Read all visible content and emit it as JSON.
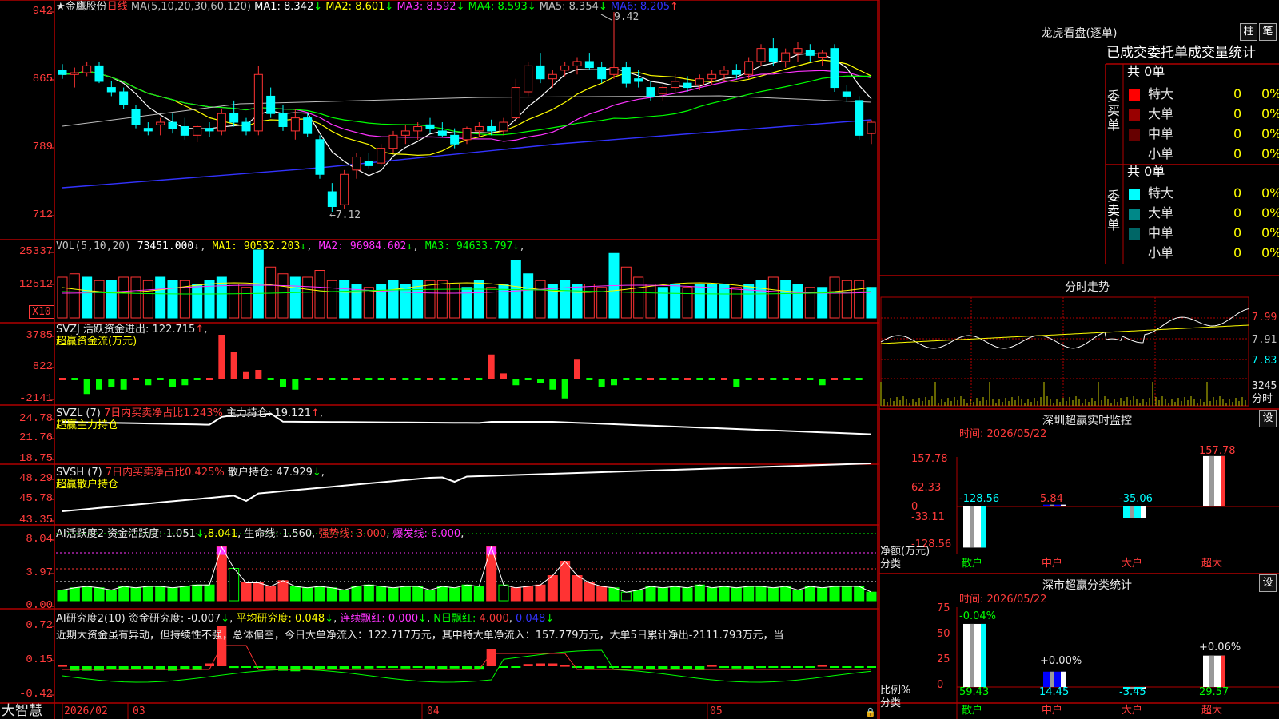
{
  "app": {
    "brand": "大智慧"
  },
  "kline": {
    "title": "★金鹰股份",
    "period": "日线",
    "ma_label": "MA(5,10,20,30,60,120)",
    "ma": [
      {
        "name": "MA1:",
        "value": "8.342",
        "dir": "↓",
        "color": "#ffffff"
      },
      {
        "name": "MA2:",
        "value": "8.601",
        "dir": "↓",
        "color": "#ffff00"
      },
      {
        "name": "MA3:",
        "value": "8.592",
        "dir": "↓",
        "color": "#ff33ff"
      },
      {
        "name": "MA4:",
        "value": "8.593",
        "dir": "↓",
        "color": "#00ff00"
      },
      {
        "name": "MA5:",
        "value": "8.354",
        "dir": "↓",
        "color": "#c0c0c0"
      },
      {
        "name": "MA6:",
        "value": "8.205",
        "dir": "↑",
        "color": "#3333ff"
      }
    ],
    "y_ticks": [
      "942",
      "865",
      "789",
      "712"
    ],
    "high_label": "9.42",
    "low_label": "←7.12"
  },
  "vol": {
    "label": "VOL(5,10,20)",
    "value": "73451.000",
    "dir": "↓",
    "ma": [
      {
        "name": "MA1:",
        "value": "90532.203",
        "dir": "↓",
        "color": "#ffff00"
      },
      {
        "name": "MA2:",
        "value": "96984.602",
        "dir": "↓",
        "color": "#ff33ff"
      },
      {
        "name": "MA3:",
        "value": "94633.797",
        "dir": "↓",
        "color": "#00ff00"
      }
    ],
    "y_ticks": [
      "25337",
      "12512"
    ],
    "unit": "X10"
  },
  "svzj": {
    "label": "SVZJ  活跃资金进出:",
    "value": "122.715",
    "dir": "↑",
    "sub": "超赢资金流(万元)",
    "y_ticks": [
      "3785",
      "822",
      "-2141"
    ]
  },
  "svzl": {
    "label": "SVZL (7)",
    "hl": "7日内买卖净占比1.243%",
    "main": "主力持仓:",
    "value": "19.121",
    "dir": "↑",
    "sub": "超赢主力持仓",
    "y_ticks": [
      "24.78",
      "21.76",
      "18.75"
    ]
  },
  "svsh": {
    "label": "SVSH (7)",
    "hl": "7日内买卖净占比0.425%",
    "main": "散户持仓:",
    "value": "47.929",
    "dir": "↓",
    "sub": "超赢散户持仓",
    "y_ticks": [
      "48.29",
      "45.78",
      "43.35"
    ]
  },
  "ai1": {
    "label": "AI活跃度2 资金活跃度:",
    "v1": "1.051",
    "d1": "↓",
    "v2": "8.041",
    "d2": ",",
    "life": "生命线:",
    "v3": "1.560",
    "strong": "强势线:",
    "v4": "3.000",
    "burst": "爆发线:",
    "v5": "6.000",
    "y_ticks": [
      "8.04",
      "3.97",
      "0.00"
    ]
  },
  "ai2": {
    "label": "AI研究度2(10) 资金研究度:",
    "v1": "-0.007",
    "d1": "↓",
    "avg": "平均研究度:",
    "v2": "0.048",
    "d2": "↓",
    "lx": "连续飘红:",
    "v3": "0.000",
    "d3": "↓",
    "n": "N日飘红:",
    "v4": "4.000",
    "v5": "0.048",
    "d5": "↓",
    "text": "近期大资金虽有异动，但持续性不强，总体偏空，今日大单净流入：122.717万元，其中特大单净流入：157.779万元，大单5日累计净出-2111.793万元，当",
    "y_ticks": [
      "0.72",
      "0.15",
      "-0.42"
    ]
  },
  "xaxis": {
    "labels": [
      "2026/02",
      "03",
      "04",
      "05"
    ]
  },
  "lhb": {
    "title": "龙虎看盘(逐单)",
    "btn1": "柱",
    "btn2": "笔",
    "head": "已成交委托单成交量统计",
    "buy": {
      "side": "委买单",
      "total": "共 0单",
      "rows": [
        {
          "name": "特大",
          "v": "0",
          "p": "0%",
          "c": "#ff0000"
        },
        {
          "name": "大单",
          "v": "0",
          "p": "0%",
          "c": "#990000"
        },
        {
          "name": "中单",
          "v": "0",
          "p": "0%",
          "c": "#660000"
        },
        {
          "name": "小单",
          "v": "0",
          "p": "0%",
          "c": ""
        }
      ]
    },
    "sell": {
      "side": "委卖单",
      "total": "共 0单",
      "rows": [
        {
          "name": "特大",
          "v": "0",
          "p": "0%",
          "c": "#00ffff"
        },
        {
          "name": "大单",
          "v": "0",
          "p": "0%",
          "c": "#008888"
        },
        {
          "name": "中单",
          "v": "0",
          "p": "0%",
          "c": "#006666"
        },
        {
          "name": "小单",
          "v": "0",
          "p": "0%",
          "c": ""
        }
      ]
    }
  },
  "fenshi": {
    "title": "分时走势",
    "y_ticks": [
      "7.99",
      "7.91",
      "7.83"
    ],
    "vol_tick": "3245",
    "unit": "分时"
  },
  "sz_monitor": {
    "title": "深圳超赢实时监控",
    "btn": "设",
    "time": "时间: 2026/05/22",
    "y_ticks": [
      "157.78",
      "62.33",
      "0",
      "-33.11",
      "-128.56"
    ],
    "ylabel": "净额(万元)",
    "xlabel": "分类",
    "cats": [
      "散户",
      "中户",
      "大户",
      "超大"
    ],
    "values": [
      -128.56,
      5.84,
      -35.06,
      157.78
    ],
    "value_labels": [
      "-128.56",
      "5.84",
      "-35.06",
      "157.78"
    ]
  },
  "sz_class": {
    "title": "深市超赢分类统计",
    "btn": "设",
    "time": "时间: 2026/05/22",
    "y_ticks": [
      "75",
      "50",
      "25",
      "0"
    ],
    "ylabel": "比例%",
    "xlabel": "分类",
    "cats": [
      "散户",
      "中户",
      "大户",
      "超大"
    ],
    "values": [
      59.43,
      14.45,
      -3.45,
      29.57
    ],
    "pct": [
      "-0.04%",
      "+0.00%",
      "",
      "+0.06%"
    ],
    "value_labels": [
      "59.43",
      "14.45",
      "-3.45",
      "29.57"
    ]
  },
  "chart_data": [
    {
      "type": "bar",
      "title": "深圳超赢实时监控",
      "categories": [
        "散户",
        "中户",
        "大户",
        "超大"
      ],
      "values": [
        -128.56,
        5.84,
        -35.06,
        157.78
      ],
      "ylabel": "净额(万元)",
      "xlabel": "分类",
      "ylim": [
        -128.56,
        157.78
      ]
    },
    {
      "type": "bar",
      "title": "深市超赢分类统计",
      "categories": [
        "散户",
        "中户",
        "大户",
        "超大"
      ],
      "values": [
        59.43,
        14.45,
        -3.45,
        29.57
      ],
      "ylabel": "比例%",
      "xlabel": "分类",
      "ylim": [
        0,
        75
      ]
    }
  ],
  "candles": [
    [
      8.75,
      8.82,
      8.65,
      8.7
    ],
    [
      8.7,
      8.78,
      8.55,
      8.72
    ],
    [
      8.72,
      8.85,
      8.68,
      8.8
    ],
    [
      8.8,
      8.85,
      8.6,
      8.62
    ],
    [
      8.55,
      8.62,
      8.45,
      8.5
    ],
    [
      8.5,
      8.55,
      8.3,
      8.35
    ],
    [
      8.3,
      8.35,
      8.08,
      8.12
    ],
    [
      8.08,
      8.15,
      8.0,
      8.05
    ],
    [
      8.12,
      8.2,
      8.0,
      8.15
    ],
    [
      8.15,
      8.25,
      8.02,
      8.08
    ],
    [
      8.1,
      8.2,
      7.95,
      8.0
    ],
    [
      8.0,
      8.12,
      7.92,
      8.1
    ],
    [
      8.08,
      8.15,
      7.98,
      8.05
    ],
    [
      8.05,
      8.3,
      8.0,
      8.25
    ],
    [
      8.25,
      8.4,
      8.1,
      8.15
    ],
    [
      8.15,
      8.2,
      8.0,
      8.05
    ],
    [
      8.05,
      8.8,
      8.0,
      8.7
    ],
    [
      8.45,
      8.55,
      8.2,
      8.25
    ],
    [
      8.25,
      8.35,
      8.05,
      8.1
    ],
    [
      8.05,
      8.3,
      7.95,
      8.2
    ],
    [
      8.2,
      8.25,
      7.98,
      8.02
    ],
    [
      7.95,
      8.0,
      7.5,
      7.55
    ],
    [
      7.35,
      7.45,
      7.12,
      7.18
    ],
    [
      7.2,
      7.6,
      7.15,
      7.55
    ],
    [
      7.6,
      7.8,
      7.5,
      7.75
    ],
    [
      7.7,
      7.8,
      7.62,
      7.65
    ],
    [
      7.68,
      7.9,
      7.65,
      7.85
    ],
    [
      7.85,
      8.05,
      7.8,
      8.0
    ],
    [
      8.0,
      8.12,
      7.9,
      8.05
    ],
    [
      8.05,
      8.15,
      7.95,
      8.1
    ],
    [
      8.12,
      8.2,
      8.02,
      8.08
    ],
    [
      8.05,
      8.15,
      7.98,
      8.0
    ],
    [
      8.0,
      8.08,
      7.85,
      7.9
    ],
    [
      7.95,
      8.1,
      7.9,
      8.08
    ],
    [
      8.05,
      8.15,
      7.98,
      8.1
    ],
    [
      8.1,
      8.18,
      8.0,
      8.05
    ],
    [
      8.05,
      8.2,
      8.0,
      8.15
    ],
    [
      8.2,
      8.65,
      8.15,
      8.55
    ],
    [
      8.5,
      8.85,
      8.45,
      8.8
    ],
    [
      8.8,
      8.95,
      8.6,
      8.65
    ],
    [
      8.65,
      8.75,
      8.55,
      8.7
    ],
    [
      8.75,
      8.85,
      8.68,
      8.8
    ],
    [
      8.8,
      8.9,
      8.7,
      8.85
    ],
    [
      8.85,
      8.95,
      8.75,
      8.78
    ],
    [
      8.78,
      8.85,
      8.6,
      8.65
    ],
    [
      8.7,
      9.42,
      8.65,
      8.78
    ],
    [
      8.78,
      8.85,
      8.55,
      8.6
    ],
    [
      8.65,
      8.75,
      8.55,
      8.62
    ],
    [
      8.55,
      8.62,
      8.4,
      8.45
    ],
    [
      8.48,
      8.58,
      8.4,
      8.55
    ],
    [
      8.55,
      8.7,
      8.48,
      8.62
    ],
    [
      8.6,
      8.68,
      8.5,
      8.55
    ],
    [
      8.58,
      8.7,
      8.52,
      8.65
    ],
    [
      8.65,
      8.75,
      8.58,
      8.7
    ],
    [
      8.7,
      8.8,
      8.62,
      8.75
    ],
    [
      8.75,
      8.82,
      8.65,
      8.7
    ],
    [
      8.7,
      8.9,
      8.65,
      8.85
    ],
    [
      8.85,
      9.05,
      8.8,
      9.0
    ],
    [
      9.0,
      9.12,
      8.8,
      8.85
    ],
    [
      8.85,
      9.0,
      8.78,
      8.95
    ],
    [
      8.95,
      9.08,
      8.85,
      9.0
    ],
    [
      8.98,
      9.05,
      8.85,
      8.92
    ],
    [
      8.9,
      8.98,
      8.8,
      8.95
    ],
    [
      9.0,
      9.05,
      8.5,
      8.55
    ],
    [
      8.5,
      8.58,
      8.38,
      8.45
    ],
    [
      8.4,
      8.45,
      7.95,
      8.0
    ],
    [
      8.02,
      8.18,
      7.9,
      8.15
    ]
  ],
  "vol_bars": [
    [
      1,
      0.6
    ],
    [
      1,
      0.65
    ],
    [
      0,
      0.6
    ],
    [
      1,
      0.55
    ],
    [
      0,
      0.55
    ],
    [
      1,
      0.6
    ],
    [
      1,
      0.6
    ],
    [
      1,
      0.55
    ],
    [
      0,
      0.6
    ],
    [
      0,
      0.55
    ],
    [
      1,
      0.55
    ],
    [
      0,
      0.5
    ],
    [
      0,
      0.55
    ],
    [
      0,
      0.6
    ],
    [
      1,
      0.5
    ],
    [
      1,
      0.45
    ],
    [
      0,
      1.0
    ],
    [
      1,
      0.75
    ],
    [
      1,
      0.65
    ],
    [
      0,
      0.6
    ],
    [
      1,
      0.6
    ],
    [
      1,
      0.7
    ],
    [
      1,
      0.55
    ],
    [
      0,
      0.55
    ],
    [
      0,
      0.5
    ],
    [
      1,
      0.45
    ],
    [
      0,
      0.5
    ],
    [
      0,
      0.55
    ],
    [
      0,
      0.5
    ],
    [
      0,
      0.55
    ],
    [
      1,
      0.55
    ],
    [
      1,
      0.55
    ],
    [
      1,
      0.5
    ],
    [
      0,
      0.45
    ],
    [
      0,
      0.55
    ],
    [
      1,
      0.45
    ],
    [
      0,
      0.5
    ],
    [
      0,
      0.85
    ],
    [
      0,
      0.65
    ],
    [
      1,
      0.55
    ],
    [
      0,
      0.5
    ],
    [
      0,
      0.55
    ],
    [
      0,
      0.5
    ],
    [
      1,
      0.5
    ],
    [
      1,
      0.45
    ],
    [
      0,
      0.95
    ],
    [
      1,
      0.75
    ],
    [
      1,
      0.6
    ],
    [
      1,
      0.5
    ],
    [
      0,
      0.45
    ],
    [
      0,
      0.5
    ],
    [
      1,
      0.45
    ],
    [
      0,
      0.5
    ],
    [
      0,
      0.5
    ],
    [
      0,
      0.5
    ],
    [
      1,
      0.45
    ],
    [
      0,
      0.5
    ],
    [
      0,
      0.55
    ],
    [
      1,
      0.6
    ],
    [
      0,
      0.55
    ],
    [
      0,
      0.5
    ],
    [
      1,
      0.45
    ],
    [
      0,
      0.45
    ],
    [
      1,
      0.6
    ],
    [
      1,
      0.55
    ],
    [
      1,
      0.55
    ],
    [
      0,
      0.45
    ]
  ],
  "svzj_bars": [
    0,
    0,
    -0.35,
    -0.25,
    -0.2,
    -0.25,
    0,
    -0.15,
    0,
    -0.2,
    -0.15,
    0,
    0,
    1.0,
    0.6,
    0.15,
    0.2,
    0,
    -0.2,
    -0.25,
    0,
    0,
    0,
    0,
    0,
    0,
    0,
    0,
    0,
    0,
    0,
    0,
    0,
    0,
    0,
    0.55,
    0.12,
    -0.15,
    0,
    -0.1,
    -0.25,
    -0.45,
    0.45,
    0,
    -0.2,
    -0.15,
    0,
    0,
    0,
    0,
    0,
    0,
    0,
    0,
    0,
    -0.2,
    0,
    0,
    0,
    0,
    0,
    0,
    -0.15,
    0,
    0,
    0
  ],
  "ai_bars": [
    [
      1,
      0.15
    ],
    [
      1,
      0.18
    ],
    [
      1,
      0.2
    ],
    [
      1,
      0.18
    ],
    [
      1,
      0.15
    ],
    [
      1,
      0.2
    ],
    [
      1,
      0.18
    ],
    [
      1,
      0.2
    ],
    [
      1,
      0.2
    ],
    [
      1,
      0.18
    ],
    [
      1,
      0.2
    ],
    [
      1,
      0.22
    ],
    [
      1,
      0.22
    ],
    [
      2,
      0.75
    ],
    [
      3,
      0.45
    ],
    [
      2,
      0.25
    ],
    [
      2,
      0.25
    ],
    [
      2,
      0.2
    ],
    [
      2,
      0.28
    ],
    [
      1,
      0.2
    ],
    [
      1,
      0.18
    ],
    [
      1,
      0.2
    ],
    [
      1,
      0.18
    ],
    [
      1,
      0.15
    ],
    [
      1,
      0.2
    ],
    [
      1,
      0.22
    ],
    [
      1,
      0.2
    ],
    [
      1,
      0.18
    ],
    [
      1,
      0.2
    ],
    [
      1,
      0.2
    ],
    [
      1,
      0.15
    ],
    [
      1,
      0.2
    ],
    [
      1,
      0.18
    ],
    [
      1,
      0.22
    ],
    [
      1,
      0.2
    ],
    [
      2,
      0.75
    ],
    [
      3,
      0.22
    ],
    [
      2,
      0.18
    ],
    [
      2,
      0.2
    ],
    [
      2,
      0.22
    ],
    [
      2,
      0.35
    ],
    [
      2,
      0.55
    ],
    [
      2,
      0.35
    ],
    [
      2,
      0.25
    ],
    [
      2,
      0.2
    ],
    [
      1,
      0.18
    ],
    [
      3,
      0.12
    ],
    [
      1,
      0.15
    ],
    [
      1,
      0.2
    ],
    [
      1,
      0.18
    ],
    [
      1,
      0.2
    ],
    [
      1,
      0.18
    ],
    [
      1,
      0.22
    ],
    [
      1,
      0.18
    ],
    [
      1,
      0.2
    ],
    [
      1,
      0.18
    ],
    [
      1,
      0.2
    ],
    [
      1,
      0.2
    ],
    [
      1,
      0.18
    ],
    [
      1,
      0.2
    ],
    [
      1,
      0.15
    ],
    [
      1,
      0.2
    ],
    [
      1,
      0.18
    ],
    [
      1,
      0.2
    ],
    [
      1,
      0.2
    ],
    [
      1,
      0.2
    ],
    [
      1,
      0.12
    ]
  ],
  "ai2_bars": [
    0.02,
    -0.08,
    -0.08,
    -0.08,
    -0.06,
    -0.07,
    -0.06,
    -0.06,
    -0.07,
    -0.08,
    -0.06,
    -0.07,
    0.05,
    0.72,
    -0.03,
    -0.02,
    -0.02,
    -0.04,
    -0.08,
    -0.09,
    -0.06,
    -0.05,
    -0.06,
    -0.05,
    -0.04,
    -0.04,
    -0.03,
    -0.03,
    -0.04,
    -0.03,
    -0.04,
    -0.05,
    -0.04,
    -0.05,
    -0.06,
    0.3,
    -0.02,
    -0.02,
    0.04,
    0.05,
    0.05,
    0.02,
    -0.02,
    -0.05,
    -0.03,
    -0.02,
    -0.02,
    -0.04,
    -0.05,
    -0.06,
    -0.05,
    -0.06,
    -0.07,
    0.02,
    -0.03,
    -0.04,
    -0.05,
    -0.03,
    -0.02,
    -0.01,
    -0.02,
    -0.01,
    0.02,
    -0.01,
    0.0,
    0.0,
    -0.0
  ]
}
